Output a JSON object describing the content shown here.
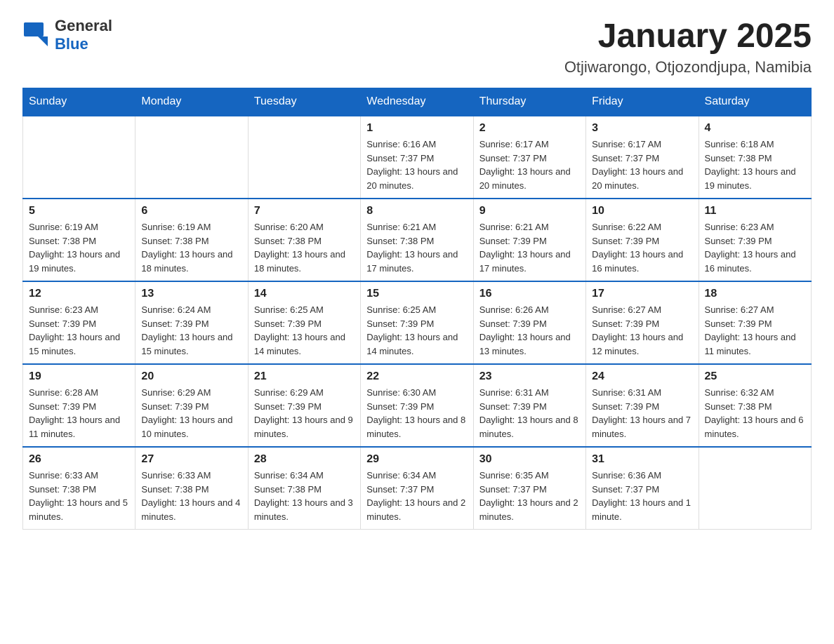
{
  "logo": {
    "general": "General",
    "blue": "Blue"
  },
  "header": {
    "month": "January 2025",
    "location": "Otjiwarongo, Otjozondjupa, Namibia"
  },
  "days_of_week": [
    "Sunday",
    "Monday",
    "Tuesday",
    "Wednesday",
    "Thursday",
    "Friday",
    "Saturday"
  ],
  "weeks": [
    [
      {
        "day": "",
        "info": ""
      },
      {
        "day": "",
        "info": ""
      },
      {
        "day": "",
        "info": ""
      },
      {
        "day": "1",
        "info": "Sunrise: 6:16 AM\nSunset: 7:37 PM\nDaylight: 13 hours and 20 minutes."
      },
      {
        "day": "2",
        "info": "Sunrise: 6:17 AM\nSunset: 7:37 PM\nDaylight: 13 hours and 20 minutes."
      },
      {
        "day": "3",
        "info": "Sunrise: 6:17 AM\nSunset: 7:37 PM\nDaylight: 13 hours and 20 minutes."
      },
      {
        "day": "4",
        "info": "Sunrise: 6:18 AM\nSunset: 7:38 PM\nDaylight: 13 hours and 19 minutes."
      }
    ],
    [
      {
        "day": "5",
        "info": "Sunrise: 6:19 AM\nSunset: 7:38 PM\nDaylight: 13 hours and 19 minutes."
      },
      {
        "day": "6",
        "info": "Sunrise: 6:19 AM\nSunset: 7:38 PM\nDaylight: 13 hours and 18 minutes."
      },
      {
        "day": "7",
        "info": "Sunrise: 6:20 AM\nSunset: 7:38 PM\nDaylight: 13 hours and 18 minutes."
      },
      {
        "day": "8",
        "info": "Sunrise: 6:21 AM\nSunset: 7:38 PM\nDaylight: 13 hours and 17 minutes."
      },
      {
        "day": "9",
        "info": "Sunrise: 6:21 AM\nSunset: 7:39 PM\nDaylight: 13 hours and 17 minutes."
      },
      {
        "day": "10",
        "info": "Sunrise: 6:22 AM\nSunset: 7:39 PM\nDaylight: 13 hours and 16 minutes."
      },
      {
        "day": "11",
        "info": "Sunrise: 6:23 AM\nSunset: 7:39 PM\nDaylight: 13 hours and 16 minutes."
      }
    ],
    [
      {
        "day": "12",
        "info": "Sunrise: 6:23 AM\nSunset: 7:39 PM\nDaylight: 13 hours and 15 minutes."
      },
      {
        "day": "13",
        "info": "Sunrise: 6:24 AM\nSunset: 7:39 PM\nDaylight: 13 hours and 15 minutes."
      },
      {
        "day": "14",
        "info": "Sunrise: 6:25 AM\nSunset: 7:39 PM\nDaylight: 13 hours and 14 minutes."
      },
      {
        "day": "15",
        "info": "Sunrise: 6:25 AM\nSunset: 7:39 PM\nDaylight: 13 hours and 14 minutes."
      },
      {
        "day": "16",
        "info": "Sunrise: 6:26 AM\nSunset: 7:39 PM\nDaylight: 13 hours and 13 minutes."
      },
      {
        "day": "17",
        "info": "Sunrise: 6:27 AM\nSunset: 7:39 PM\nDaylight: 13 hours and 12 minutes."
      },
      {
        "day": "18",
        "info": "Sunrise: 6:27 AM\nSunset: 7:39 PM\nDaylight: 13 hours and 11 minutes."
      }
    ],
    [
      {
        "day": "19",
        "info": "Sunrise: 6:28 AM\nSunset: 7:39 PM\nDaylight: 13 hours and 11 minutes."
      },
      {
        "day": "20",
        "info": "Sunrise: 6:29 AM\nSunset: 7:39 PM\nDaylight: 13 hours and 10 minutes."
      },
      {
        "day": "21",
        "info": "Sunrise: 6:29 AM\nSunset: 7:39 PM\nDaylight: 13 hours and 9 minutes."
      },
      {
        "day": "22",
        "info": "Sunrise: 6:30 AM\nSunset: 7:39 PM\nDaylight: 13 hours and 8 minutes."
      },
      {
        "day": "23",
        "info": "Sunrise: 6:31 AM\nSunset: 7:39 PM\nDaylight: 13 hours and 8 minutes."
      },
      {
        "day": "24",
        "info": "Sunrise: 6:31 AM\nSunset: 7:39 PM\nDaylight: 13 hours and 7 minutes."
      },
      {
        "day": "25",
        "info": "Sunrise: 6:32 AM\nSunset: 7:38 PM\nDaylight: 13 hours and 6 minutes."
      }
    ],
    [
      {
        "day": "26",
        "info": "Sunrise: 6:33 AM\nSunset: 7:38 PM\nDaylight: 13 hours and 5 minutes."
      },
      {
        "day": "27",
        "info": "Sunrise: 6:33 AM\nSunset: 7:38 PM\nDaylight: 13 hours and 4 minutes."
      },
      {
        "day": "28",
        "info": "Sunrise: 6:34 AM\nSunset: 7:38 PM\nDaylight: 13 hours and 3 minutes."
      },
      {
        "day": "29",
        "info": "Sunrise: 6:34 AM\nSunset: 7:37 PM\nDaylight: 13 hours and 2 minutes."
      },
      {
        "day": "30",
        "info": "Sunrise: 6:35 AM\nSunset: 7:37 PM\nDaylight: 13 hours and 2 minutes."
      },
      {
        "day": "31",
        "info": "Sunrise: 6:36 AM\nSunset: 7:37 PM\nDaylight: 13 hours and 1 minute."
      },
      {
        "day": "",
        "info": ""
      }
    ]
  ]
}
